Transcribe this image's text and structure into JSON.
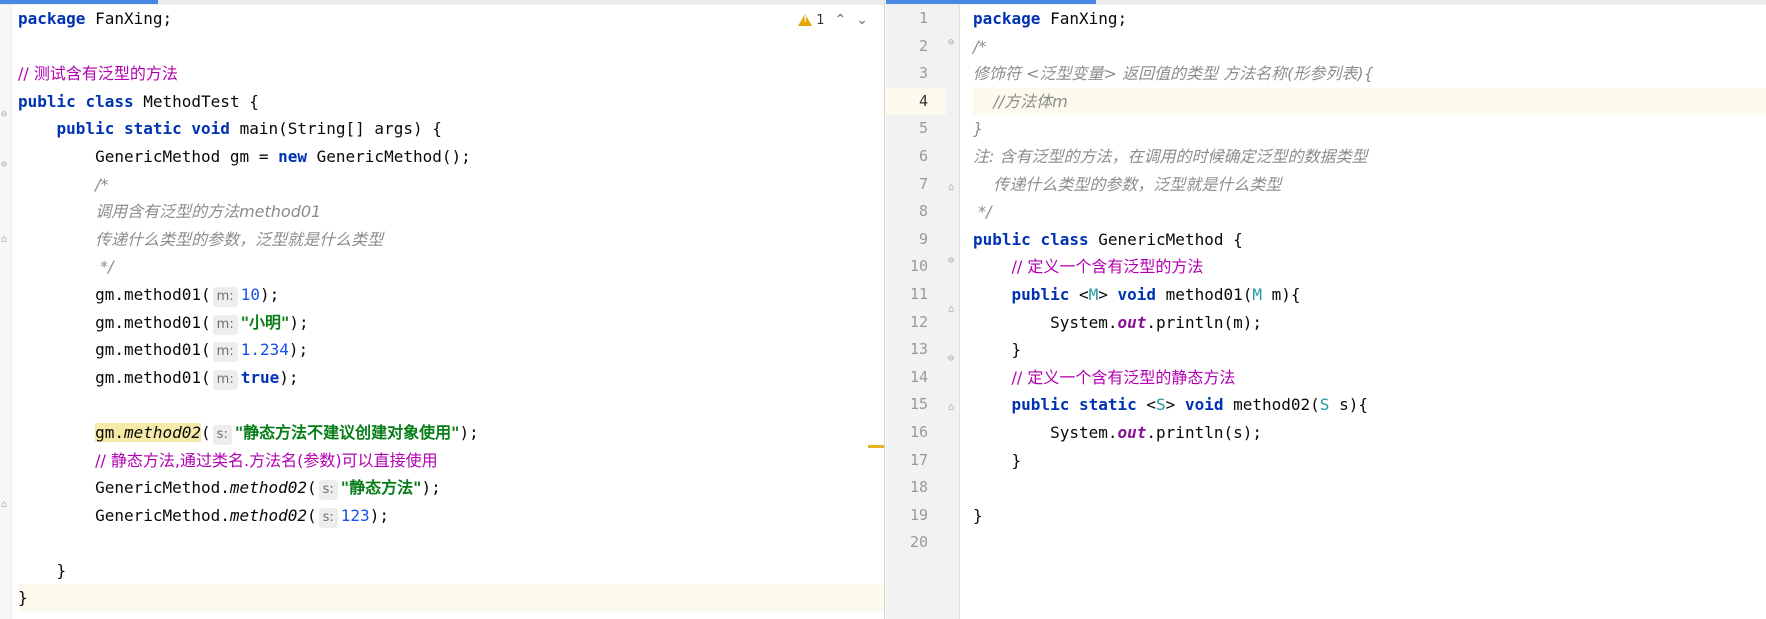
{
  "left_editor": {
    "inspector": {
      "warning_count": "1",
      "up_label": "⌃",
      "down_label": "⌄"
    },
    "lines": {
      "l1_kw": "package",
      "l1_rest": " FanXing;",
      "l3": "// 测试含有泛型的方法",
      "l4_kw1": "public",
      "l4_kw2": "class",
      "l4_rest": " MethodTest {",
      "l5_kw1": "public",
      "l5_kw2": "static",
      "l5_kw3": "void",
      "l5_rest": " main(String[] args) {",
      "l6_a": "GenericMethod gm = ",
      "l6_kw": "new",
      "l6_b": " GenericMethod();",
      "l7": "/*",
      "l8": "调用含有泛型的方法method01",
      "l9": "传递什么类型的参数，泛型就是什么类型",
      "l10": " */",
      "l11_a": "gm.method01(",
      "l11_hint": "m:",
      "l11_val": "10",
      "l11_b": ");",
      "l12_a": "gm.method01(",
      "l12_hint": "m:",
      "l12_val": "\"小明\"",
      "l12_b": ");",
      "l13_a": "gm.method01(",
      "l13_hint": "m:",
      "l13_val": "1.234",
      "l13_b": ");",
      "l14_a": "gm.method01(",
      "l14_hint": "m:",
      "l14_val": "true",
      "l14_b": ");",
      "l16_gm": "gm.",
      "l16_m": "method02",
      "l16_a": "(",
      "l16_hint": "s:",
      "l16_val": "\"静态方法不建议创建对象使用\"",
      "l16_b": ");",
      "l17": "// 静态方法,通过类名.方法名(参数)可以直接使用",
      "l18_a": "GenericMethod.",
      "l18_m": "method02",
      "l18_b": "(",
      "l18_hint": "s:",
      "l18_val": "\"静态方法\"",
      "l18_c": ");",
      "l19_a": "GenericMethod.",
      "l19_m": "method02",
      "l19_b": "(",
      "l19_hint": "s:",
      "l19_val": "123",
      "l19_c": ");",
      "l21": "}",
      "l22": "}"
    }
  },
  "right_editor": {
    "line_numbers": [
      "1",
      "2",
      "3",
      "4",
      "5",
      "6",
      "7",
      "8",
      "9",
      "10",
      "11",
      "12",
      "13",
      "14",
      "15",
      "16",
      "17",
      "18",
      "19",
      "20"
    ],
    "current_line": "4",
    "lines": {
      "r1_kw": "package",
      "r1_rest": " FanXing;",
      "r2": "/*",
      "r3": "修饰符 <泛型变量> 返回值的类型 方法名称(形参列表){",
      "r4": "    //方法体m",
      "r5": "}",
      "r6": "注: 含有泛型的方法，在调用的时候确定泛型的数据类型",
      "r7": "    传递什么类型的参数，泛型就是什么类型",
      "r8": " */",
      "r9_kw1": "public",
      "r9_kw2": "class",
      "r9_rest": " GenericMethod {",
      "r10": "// 定义一个含有泛型的方法",
      "r11_kw": "public",
      "r11_lt": " <",
      "r11_tp": "M",
      "r11_gt": "> ",
      "r11_kw2": "void",
      "r11_a": " method01(",
      "r11_tp2": "M",
      "r11_b": " m){",
      "r12_a": "System.",
      "r12_f": "out",
      "r12_b": ".println(m);",
      "r13": "}",
      "r14": "// 定义一个含有泛型的静态方法",
      "r15_kw": "public",
      "r15_kw2": "static",
      "r15_lt": " <",
      "r15_tp": "S",
      "r15_gt": "> ",
      "r15_kw3": "void",
      "r15_a": " method02(",
      "r15_tp2": "S",
      "r15_b": " s){",
      "r16_a": "System.",
      "r16_f": "out",
      "r16_b": ".println(s);",
      "r17": "}",
      "r19": "}"
    }
  }
}
